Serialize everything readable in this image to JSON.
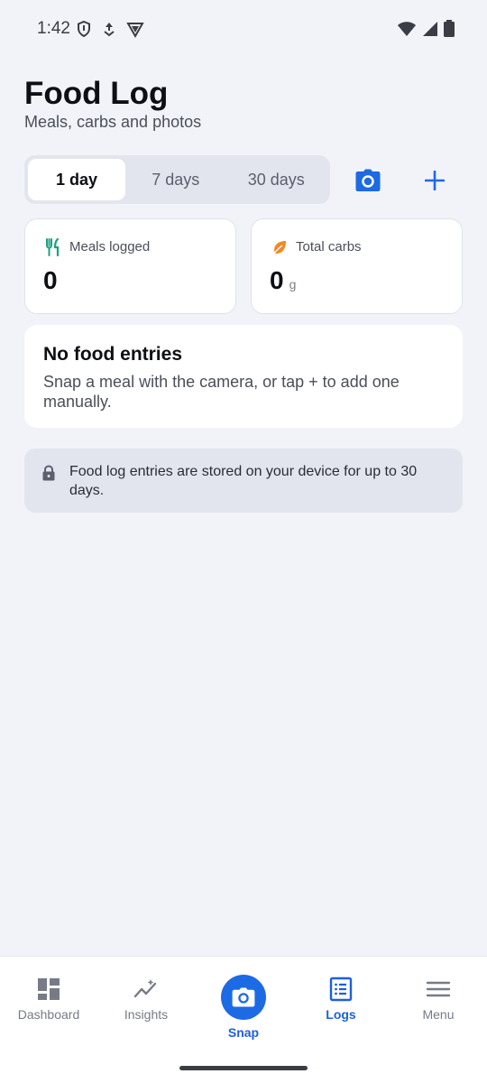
{
  "status_bar": {
    "time": "1:42",
    "icons_left": [
      "shield-icon",
      "data-saver-icon",
      "vpn-icon"
    ],
    "icons_right": [
      "wifi-icon",
      "signal-icon",
      "battery-icon"
    ]
  },
  "header": {
    "title": "Food Log",
    "subtitle": "Meals, carbs and photos"
  },
  "range": {
    "tabs": [
      {
        "label": "1 day",
        "active": true
      },
      {
        "label": "7 days",
        "active": false
      },
      {
        "label": "30 days",
        "active": false
      }
    ]
  },
  "actions": {
    "camera_icon": "camera-icon",
    "add_icon": "plus-icon"
  },
  "stats": {
    "meals": {
      "label": "Meals logged",
      "value": "0",
      "icon": "fork-knife-icon"
    },
    "carbs": {
      "label": "Total carbs",
      "value": "0",
      "unit": "g",
      "icon": "leaf-icon"
    }
  },
  "empty_state": {
    "title": "No food entries",
    "description": "Snap a meal with the camera, or tap + to add one manually."
  },
  "info_note": {
    "text": "Food log entries are stored on your device for up to 30 days.",
    "icon": "lock-icon"
  },
  "nav": {
    "items": [
      {
        "label": "Dashboard",
        "icon": "dashboard-icon",
        "active": false
      },
      {
        "label": "Insights",
        "icon": "insights-icon",
        "active": false
      },
      {
        "label": "Snap",
        "icon": "camera-icon",
        "active": false
      },
      {
        "label": "Logs",
        "icon": "list-icon",
        "active": true
      },
      {
        "label": "Menu",
        "icon": "menu-icon",
        "active": false
      }
    ]
  },
  "colors": {
    "accent": "#1d6ae5",
    "background": "#f2f3f8",
    "meals_icon": "#1aa382",
    "carbs_icon": "#f08a24"
  }
}
